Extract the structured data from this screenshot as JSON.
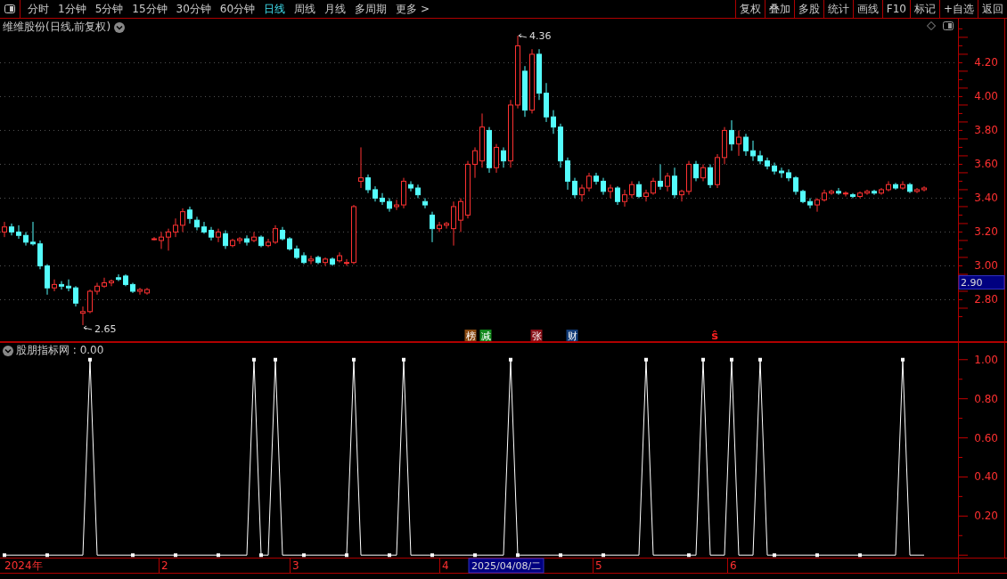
{
  "toolbar": {
    "periods": [
      {
        "label": "分时",
        "selected": false
      },
      {
        "label": "1分钟",
        "selected": false
      },
      {
        "label": "5分钟",
        "selected": false
      },
      {
        "label": "15分钟",
        "selected": false
      },
      {
        "label": "30分钟",
        "selected": false
      },
      {
        "label": "60分钟",
        "selected": false
      },
      {
        "label": "日线",
        "selected": true
      },
      {
        "label": "周线",
        "selected": false
      },
      {
        "label": "月线",
        "selected": false
      },
      {
        "label": "多周期",
        "selected": false
      },
      {
        "label": "更多 >",
        "selected": false
      }
    ],
    "actions": [
      "复权",
      "叠加",
      "多股",
      "统计",
      "画线",
      "F10",
      "标记",
      "+自选",
      "返回"
    ]
  },
  "main_chart": {
    "title": "维维股份(日线,前复权)",
    "high_label": "4.36",
    "low_label": "2.65",
    "current_price": "2.90",
    "chart_data": {
      "type": "candlestick",
      "ylim": [
        2.55,
        4.46
      ],
      "grid": true,
      "yticks": [
        {
          "value": 4.2,
          "label": "4.20"
        },
        {
          "value": 4.0,
          "label": "4.00"
        },
        {
          "value": 3.8,
          "label": "3.80"
        },
        {
          "value": 3.6,
          "label": "3.60"
        },
        {
          "value": 3.4,
          "label": "3.40"
        },
        {
          "value": 3.2,
          "label": "3.20"
        },
        {
          "value": 3.0,
          "label": "3.00"
        },
        {
          "value": 2.8,
          "label": "2.80"
        }
      ],
      "ohlc": [
        [
          3.2,
          3.26,
          3.17,
          3.23
        ],
        [
          3.23,
          3.25,
          3.18,
          3.2
        ],
        [
          3.2,
          3.24,
          3.16,
          3.18
        ],
        [
          3.18,
          3.2,
          3.12,
          3.14
        ],
        [
          3.14,
          3.26,
          3.12,
          3.13
        ],
        [
          3.13,
          3.15,
          2.98,
          3.0
        ],
        [
          3.0,
          3.01,
          2.83,
          2.87
        ],
        [
          2.87,
          2.92,
          2.85,
          2.89
        ],
        [
          2.89,
          2.91,
          2.86,
          2.88
        ],
        [
          2.88,
          2.92,
          2.85,
          2.87
        ],
        [
          2.87,
          2.88,
          2.76,
          2.78
        ],
        [
          2.72,
          2.76,
          2.65,
          2.73
        ],
        [
          2.73,
          2.86,
          2.72,
          2.85
        ],
        [
          2.85,
          2.9,
          2.83,
          2.88
        ],
        [
          2.88,
          2.93,
          2.87,
          2.9
        ],
        [
          2.9,
          2.92,
          2.88,
          2.91
        ],
        [
          2.93,
          2.95,
          2.91,
          2.92
        ],
        [
          2.94,
          2.95,
          2.88,
          2.89
        ],
        [
          2.89,
          2.9,
          2.84,
          2.85
        ],
        [
          2.85,
          2.87,
          2.83,
          2.86
        ],
        [
          2.84,
          2.87,
          2.83,
          2.86
        ],
        [
          3.16,
          3.17,
          3.15,
          3.16
        ],
        [
          3.15,
          3.2,
          3.1,
          3.17
        ],
        [
          3.17,
          3.22,
          3.09,
          3.2
        ],
        [
          3.2,
          3.28,
          3.17,
          3.24
        ],
        [
          3.24,
          3.34,
          3.2,
          3.32
        ],
        [
          3.33,
          3.35,
          3.25,
          3.28
        ],
        [
          3.27,
          3.29,
          3.21,
          3.23
        ],
        [
          3.23,
          3.26,
          3.19,
          3.2
        ],
        [
          3.21,
          3.23,
          3.15,
          3.17
        ],
        [
          3.17,
          3.22,
          3.14,
          3.2
        ],
        [
          3.19,
          3.21,
          3.1,
          3.12
        ],
        [
          3.12,
          3.16,
          3.11,
          3.15
        ],
        [
          3.15,
          3.17,
          3.13,
          3.16
        ],
        [
          3.16,
          3.18,
          3.12,
          3.14
        ],
        [
          3.15,
          3.2,
          3.14,
          3.17
        ],
        [
          3.17,
          3.18,
          3.11,
          3.12
        ],
        [
          3.12,
          3.16,
          3.11,
          3.14
        ],
        [
          3.14,
          3.24,
          3.13,
          3.22
        ],
        [
          3.21,
          3.23,
          3.15,
          3.16
        ],
        [
          3.16,
          3.17,
          3.09,
          3.1
        ],
        [
          3.1,
          3.12,
          3.04,
          3.05
        ],
        [
          3.06,
          3.08,
          3.01,
          3.02
        ],
        [
          3.03,
          3.06,
          3.01,
          3.04
        ],
        [
          3.05,
          3.06,
          3.01,
          3.02
        ],
        [
          3.02,
          3.05,
          3.0,
          3.04
        ],
        [
          3.04,
          3.05,
          3.0,
          3.01
        ],
        [
          3.03,
          3.08,
          3.02,
          3.06
        ],
        [
          3.02,
          3.04,
          3.0,
          3.02
        ],
        [
          3.02,
          3.36,
          3.01,
          3.35
        ],
        [
          3.5,
          3.7,
          3.46,
          3.52
        ],
        [
          3.52,
          3.54,
          3.43,
          3.45
        ],
        [
          3.45,
          3.47,
          3.38,
          3.4
        ],
        [
          3.4,
          3.43,
          3.36,
          3.38
        ],
        [
          3.38,
          3.4,
          3.32,
          3.34
        ],
        [
          3.35,
          3.39,
          3.33,
          3.36
        ],
        [
          3.36,
          3.52,
          3.34,
          3.5
        ],
        [
          3.48,
          3.5,
          3.44,
          3.46
        ],
        [
          3.46,
          3.48,
          3.4,
          3.42
        ],
        [
          3.38,
          3.4,
          3.34,
          3.36
        ],
        [
          3.3,
          3.32,
          3.14,
          3.22
        ],
        [
          3.22,
          3.26,
          3.2,
          3.24
        ],
        [
          3.24,
          3.26,
          3.22,
          3.25
        ],
        [
          3.22,
          3.38,
          3.12,
          3.35
        ],
        [
          3.27,
          3.4,
          3.2,
          3.38
        ],
        [
          3.3,
          3.62,
          3.28,
          3.6
        ],
        [
          3.6,
          3.7,
          3.52,
          3.68
        ],
        [
          3.62,
          3.9,
          3.58,
          3.82
        ],
        [
          3.8,
          3.82,
          3.55,
          3.58
        ],
        [
          3.58,
          3.72,
          3.55,
          3.7
        ],
        [
          3.68,
          3.7,
          3.58,
          3.62
        ],
        [
          3.62,
          3.98,
          3.58,
          3.95
        ],
        [
          3.95,
          4.36,
          3.93,
          4.3
        ],
        [
          4.15,
          4.18,
          3.88,
          3.92
        ],
        [
          3.92,
          4.28,
          3.9,
          4.25
        ],
        [
          4.25,
          4.28,
          3.98,
          4.02
        ],
        [
          4.02,
          4.08,
          3.85,
          3.88
        ],
        [
          3.88,
          3.92,
          3.78,
          3.82
        ],
        [
          3.82,
          3.84,
          3.58,
          3.62
        ],
        [
          3.62,
          3.64,
          3.45,
          3.5
        ],
        [
          3.5,
          3.52,
          3.4,
          3.42
        ],
        [
          3.42,
          3.48,
          3.38,
          3.46
        ],
        [
          3.46,
          3.55,
          3.44,
          3.53
        ],
        [
          3.53,
          3.55,
          3.48,
          3.5
        ],
        [
          3.5,
          3.52,
          3.42,
          3.44
        ],
        [
          3.44,
          3.48,
          3.4,
          3.46
        ],
        [
          3.46,
          3.47,
          3.36,
          3.38
        ],
        [
          3.38,
          3.45,
          3.35,
          3.42
        ],
        [
          3.42,
          3.5,
          3.4,
          3.48
        ],
        [
          3.48,
          3.5,
          3.4,
          3.41
        ],
        [
          3.41,
          3.45,
          3.38,
          3.43
        ],
        [
          3.43,
          3.52,
          3.42,
          3.5
        ],
        [
          3.5,
          3.6,
          3.45,
          3.47
        ],
        [
          3.47,
          3.55,
          3.44,
          3.53
        ],
        [
          3.53,
          3.58,
          3.4,
          3.42
        ],
        [
          3.42,
          3.45,
          3.38,
          3.44
        ],
        [
          3.44,
          3.62,
          3.42,
          3.6
        ],
        [
          3.6,
          3.62,
          3.5,
          3.52
        ],
        [
          3.52,
          3.6,
          3.5,
          3.58
        ],
        [
          3.58,
          3.6,
          3.46,
          3.48
        ],
        [
          3.48,
          3.66,
          3.46,
          3.64
        ],
        [
          3.64,
          3.82,
          3.6,
          3.8
        ],
        [
          3.8,
          3.86,
          3.68,
          3.72
        ],
        [
          3.72,
          3.8,
          3.65,
          3.76
        ],
        [
          3.76,
          3.78,
          3.65,
          3.68
        ],
        [
          3.68,
          3.74,
          3.62,
          3.65
        ],
        [
          3.65,
          3.68,
          3.6,
          3.62
        ],
        [
          3.62,
          3.64,
          3.57,
          3.59
        ],
        [
          3.59,
          3.61,
          3.54,
          3.56
        ],
        [
          3.56,
          3.58,
          3.52,
          3.55
        ],
        [
          3.55,
          3.57,
          3.5,
          3.52
        ],
        [
          3.52,
          3.53,
          3.42,
          3.44
        ],
        [
          3.44,
          3.45,
          3.37,
          3.38
        ],
        [
          3.38,
          3.4,
          3.34,
          3.36
        ],
        [
          3.36,
          3.4,
          3.32,
          3.39
        ],
        [
          3.39,
          3.45,
          3.38,
          3.43
        ],
        [
          3.43,
          3.45,
          3.42,
          3.44
        ],
        [
          3.44,
          3.46,
          3.42,
          3.43
        ],
        [
          3.43,
          3.44,
          3.41,
          3.43
        ],
        [
          3.42,
          3.43,
          3.4,
          3.41
        ],
        [
          3.41,
          3.44,
          3.4,
          3.43
        ],
        [
          3.43,
          3.45,
          3.42,
          3.44
        ],
        [
          3.44,
          3.45,
          3.42,
          3.43
        ],
        [
          3.43,
          3.46,
          3.42,
          3.45
        ],
        [
          3.45,
          3.5,
          3.44,
          3.48
        ],
        [
          3.48,
          3.49,
          3.45,
          3.46
        ],
        [
          3.46,
          3.5,
          3.45,
          3.48
        ],
        [
          3.48,
          3.49,
          3.43,
          3.44
        ],
        [
          3.44,
          3.46,
          3.43,
          3.45
        ],
        [
          3.45,
          3.47,
          3.44,
          3.46
        ]
      ]
    },
    "events": [
      {
        "label": "榜",
        "color": "#8a4a12"
      },
      {
        "label": "减",
        "color": "#128a1c"
      },
      {
        "label": "张",
        "color": "#8a1018"
      },
      {
        "label": "财",
        "color": "#123c78"
      },
      {
        "label": "ŝ",
        "color": "#ff2020"
      }
    ]
  },
  "indicator": {
    "title": "股朋指标网 : 0.00",
    "chart_data": {
      "type": "line",
      "ylim": [
        -0.09,
        1.09
      ],
      "yticks": [
        {
          "value": 0.2,
          "label": "0.20"
        },
        {
          "value": 0.4,
          "label": "0.40"
        },
        {
          "value": 0.6,
          "label": "0.60"
        },
        {
          "value": 0.8,
          "label": "0.80"
        },
        {
          "value": 1,
          "label": "1.00"
        }
      ],
      "series": [
        {
          "color": "#ffffff",
          "values": [
            0,
            0,
            0,
            0,
            0,
            0,
            0,
            0,
            0,
            0,
            0,
            0,
            1,
            0,
            0,
            0,
            0,
            0,
            0,
            0,
            0,
            0,
            0,
            0,
            0,
            0,
            0,
            0,
            0,
            0,
            0,
            0,
            0,
            0,
            0,
            1,
            0,
            0,
            1,
            0,
            0,
            0,
            0,
            0,
            0,
            0,
            0,
            0,
            0,
            1,
            0,
            0,
            0,
            0,
            0,
            0,
            1,
            0,
            0,
            0,
            0,
            0,
            0,
            0,
            0,
            0,
            0,
            0,
            0,
            0,
            0,
            1,
            0,
            0,
            0,
            0,
            0,
            0,
            0,
            0,
            0,
            0,
            0,
            0,
            0,
            0,
            0,
            0,
            0,
            0,
            1,
            0,
            0,
            0,
            0,
            0,
            0,
            0,
            1,
            0,
            0,
            0,
            1,
            0,
            0,
            0,
            1,
            0,
            0,
            0,
            0,
            0,
            0,
            0,
            0,
            0,
            0,
            0,
            0,
            0,
            0,
            0,
            0,
            0,
            0,
            0,
            1,
            0,
            0,
            0
          ]
        }
      ]
    }
  },
  "time_axis": [
    {
      "label": "2024年",
      "kind": "tick"
    },
    {
      "label": "2",
      "kind": "tick"
    },
    {
      "label": "3",
      "kind": "tick"
    },
    {
      "label": "4",
      "kind": "tick"
    },
    {
      "label": "2025/04/08/二",
      "kind": "cursor"
    },
    {
      "label": "5",
      "kind": "tick"
    },
    {
      "label": "6",
      "kind": "tick"
    }
  ]
}
